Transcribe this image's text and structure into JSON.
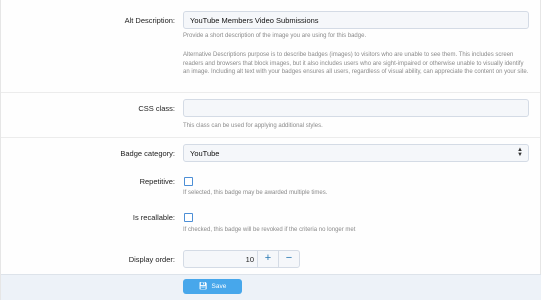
{
  "form": {
    "alt_description": {
      "label": "Alt Description:",
      "value": "YouTube Members Video Submissions",
      "help1": "Provide a short description of the image you are using for this badge.",
      "help2": "Alternative Descriptions purpose is to describe badges (images) to visitors who are unable to see them. This includes screen readers and browsers that block images, but it also includes users who are sight-impaired or otherwise unable to visually identify an image. Including alt text with your badges ensures all users, regardless of visual ability, can appreciate the content on your site."
    },
    "css_class": {
      "label": "CSS class:",
      "value": "",
      "help": "This class can be used for applying additional styles."
    },
    "badge_category": {
      "label": "Badge category:",
      "selected": "YouTube"
    },
    "repetitive": {
      "label": "Repetitive:",
      "checked": false,
      "help": "If selected, this badge may be awarded multiple times."
    },
    "is_recallable": {
      "label": "Is recallable:",
      "checked": false,
      "help": "If checked, this badge will be revoked if the criteria no longer met"
    },
    "display_order": {
      "label": "Display order:",
      "value": "10",
      "plus": "+",
      "minus": "−"
    }
  },
  "footer": {
    "save_label": "Save",
    "save_icon": "save-icon"
  },
  "colors": {
    "accent": "#47a7eb",
    "link": "#2577b1",
    "checkbox_border": "#4d8fd6"
  }
}
